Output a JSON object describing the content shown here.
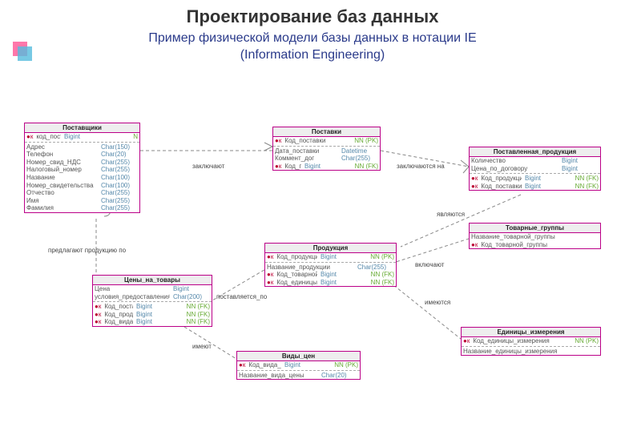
{
  "title": "Проектирование баз данных",
  "subtitle_line1": "Пример физической модели базы данных в нотации IE",
  "subtitle_line2": "(Information Engineering)",
  "entities": {
    "suppliers": {
      "name": "Поставщики",
      "pk": [
        {
          "field": "код_поставщика",
          "type": "Bigint",
          "cons": "N"
        }
      ],
      "cols": [
        {
          "field": "Адрес",
          "type": "Char(150)"
        },
        {
          "field": "Телефон",
          "type": "Char(20)"
        },
        {
          "field": "Номер_свид_НДС",
          "type": "Char(255)"
        },
        {
          "field": "Налоговый_номер",
          "type": "Char(255)"
        },
        {
          "field": "Название",
          "type": "Char(100)"
        },
        {
          "field": "Номер_свидетельства",
          "type": "Char(100)"
        },
        {
          "field": "Отчество",
          "type": "Char(255)"
        },
        {
          "field": "Имя",
          "type": "Char(255)"
        },
        {
          "field": "Фамилия",
          "type": "Char(255)"
        }
      ]
    },
    "deliveries": {
      "name": "Поставки",
      "pk": [
        {
          "field": "Код_поставки",
          "type": "",
          "cons": "NN (PK)"
        }
      ],
      "cols": [
        {
          "field": "Дата_поставки",
          "type": "Datetime"
        },
        {
          "field": "Коммент_дог",
          "type": "Char(255)"
        },
        {
          "field": "Код_поставщика",
          "type": "Bigint",
          "cons": "NN (FK)"
        }
      ]
    },
    "supply_products": {
      "name": "Поставленная_продукция",
      "cols": [
        {
          "field": "Количество",
          "type": "Bigint"
        },
        {
          "field": "Цена_по_договору",
          "type": "Bigint"
        },
        {
          "field": "Код_продукции",
          "type": "Bigint",
          "cons": "NN (FK)"
        },
        {
          "field": "Код_поставки",
          "type": "Bigint",
          "cons": "NN (FK)"
        }
      ]
    },
    "products": {
      "name": "Продукция",
      "pk": [
        {
          "field": "Код_продукции",
          "type": "Bigint",
          "cons": "NN (PK)"
        }
      ],
      "cols": [
        {
          "field": "Название_продукции",
          "type": "Char(255)"
        },
        {
          "field": "Код_товарной_группы",
          "type": "Bigint",
          "cons": "NN (FK)"
        },
        {
          "field": "Код_единицы_измерения",
          "type": "Bigint",
          "cons": "NN (FK)"
        }
      ]
    },
    "product_groups": {
      "name": "Товарные_группы",
      "pk": [
        {
          "field": "Код_товарной_группы",
          "type": "",
          "cons": ""
        }
      ],
      "cols": [
        {
          "field": "Название_товарной_группы",
          "type": ""
        }
      ]
    },
    "pricelist": {
      "name": "Цены_на_товары",
      "pk": [
        {
          "field": "Цена",
          "type": "Bigint"
        },
        {
          "field": "условия_предоставления",
          "type": "Char(200)"
        }
      ],
      "cols": [
        {
          "field": "Код_поставщика",
          "type": "Bigint",
          "cons": "NN (FK)"
        },
        {
          "field": "Код_продукции",
          "type": "Bigint",
          "cons": "NN (FK)"
        },
        {
          "field": "Код_вида_цены",
          "type": "Bigint",
          "cons": "NN (FK)"
        }
      ]
    },
    "price_types": {
      "name": "Виды_цен",
      "pk": [
        {
          "field": "Код_вида_цены",
          "type": "Bigint",
          "cons": "NN (PK)"
        }
      ],
      "cols": [
        {
          "field": "Название_вида_цены",
          "type": "Char(20)"
        }
      ]
    },
    "units": {
      "name": "Единицы_измерения",
      "pk": [
        {
          "field": "Код_единицы_измерения",
          "type": "",
          "cons": "NN (PK)"
        }
      ],
      "cols": [
        {
          "field": "Название_единицы_измерения",
          "type": ""
        }
      ]
    }
  },
  "relations": {
    "r1": "заключают",
    "r2": "заключаются на",
    "r3": "являются",
    "r4": "предлагают продукцию по",
    "r5": "включают",
    "r6": "поставляется_по",
    "r7": "имеют",
    "r8": "имеются"
  }
}
